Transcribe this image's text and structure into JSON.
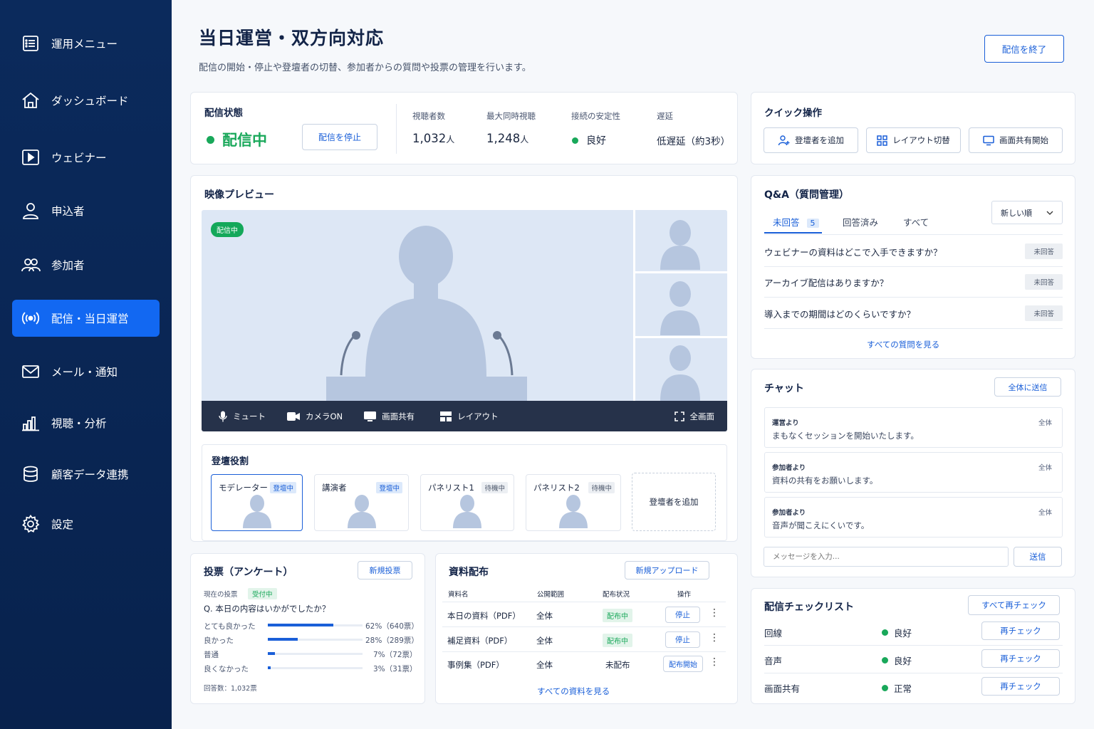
{
  "sidebar": {
    "items": [
      {
        "label": "運用メニュー",
        "icon": "menu-list-icon"
      },
      {
        "label": "ダッシュボード",
        "icon": "home-icon"
      },
      {
        "label": "ウェビナー",
        "icon": "play-icon"
      },
      {
        "label": "申込者",
        "icon": "user-icon"
      },
      {
        "label": "参加者",
        "icon": "users-icon"
      },
      {
        "label": "配信・当日運営",
        "icon": "broadcast-icon",
        "active": true
      },
      {
        "label": "メール・通知",
        "icon": "mail-icon"
      },
      {
        "label": "視聴・分析",
        "icon": "bar-chart-icon"
      },
      {
        "label": "顧客データ連携",
        "icon": "database-icon"
      },
      {
        "label": "設定",
        "icon": "gear-icon"
      }
    ]
  },
  "header": {
    "title": "当日運営・双方向対応",
    "description": "配信の開始・停止や登壇者の切替、参加者からの質問や投票の管理を行います。",
    "end_button": "配信を終了"
  },
  "status": {
    "title": "配信状態",
    "state": "配信中",
    "stop_button": "配信を停止",
    "viewers_label": "視聴者数",
    "viewers_value": "1,032",
    "viewers_unit": "人",
    "peak_label": "最大同時視聴",
    "peak_value": "1,248",
    "peak_unit": "人",
    "stability_label": "接続の安定性",
    "stability_value": "良好",
    "latency_label": "遅延",
    "latency_value": "低遅延（約3秒）"
  },
  "quick": {
    "title": "クイック操作",
    "add_speaker": "登壇者を追加",
    "layout": "レイアウト切替",
    "share": "画面共有開始"
  },
  "preview": {
    "title": "映像プレビュー",
    "live_badge": "配信中",
    "controls": {
      "mute": "ミュート",
      "camera": "カメラON",
      "share": "画面共有",
      "layout": "レイアウト",
      "fullscreen": "全画面"
    }
  },
  "roles": {
    "title": "登壇役割",
    "items": [
      {
        "name": "モデレーター",
        "badge": "登壇中",
        "status": "live"
      },
      {
        "name": "講演者",
        "badge": "登壇中",
        "status": "live"
      },
      {
        "name": "パネリスト1",
        "badge": "待機中",
        "status": "wait"
      },
      {
        "name": "パネリスト2",
        "badge": "待機中",
        "status": "wait"
      }
    ],
    "add": "登壇者を追加"
  },
  "poll": {
    "title": "投票（アンケート）",
    "new_button": "新規投票",
    "current_label": "現在の投票",
    "current_badge": "受付中",
    "question": "Q. 本日の内容はいかがでしたか？",
    "options": [
      {
        "label": "とても良かった",
        "pct": 62,
        "result": "62%（640票）"
      },
      {
        "label": "良かった",
        "pct": 28,
        "result": "28%（289票）"
      },
      {
        "label": "普通",
        "pct": 7,
        "result": "7%（72票）"
      },
      {
        "label": "良くなかった",
        "pct": 3,
        "result": "3%（31票）"
      }
    ],
    "total": "回答数：1,032票"
  },
  "materials": {
    "title": "資料配布",
    "upload_button": "新規アップロード",
    "headers": [
      "資料名",
      "公開範囲",
      "配布状況",
      "操作"
    ],
    "rows": [
      {
        "name": "本日の資料（PDF）",
        "scope": "全体",
        "status": "配布中",
        "action": "停止"
      },
      {
        "name": "補足資料（PDF）",
        "scope": "全体",
        "status": "配布中",
        "action": "停止"
      },
      {
        "name": "事例集（PDF）",
        "scope": "全体",
        "status": "未配布",
        "action": "配布開始"
      }
    ],
    "view_all": "すべての資料を見る"
  },
  "qa": {
    "title": "Q&A（質問管理）",
    "tabs": {
      "unanswered": "未回答",
      "unanswered_count": "5",
      "answered": "回答済み",
      "all": "すべて"
    },
    "sort": "新しい順",
    "questions": [
      {
        "text": "ウェビナーの資料はどこで入手できますか？",
        "status": "未回答"
      },
      {
        "text": "アーカイブ配信はありますか？",
        "status": "未回答"
      },
      {
        "text": "導入までの期間はどのくらいですか？",
        "status": "未回答"
      }
    ],
    "view_all": "すべての質問を見る"
  },
  "chat": {
    "title": "チャット",
    "send_all": "全体に送信",
    "messages": [
      {
        "from": "運営より",
        "to": "全体",
        "text": "まもなくセッションを開始いたします。"
      },
      {
        "from": "参加者より",
        "to": "全体",
        "text": "資料の共有をお願いします。"
      },
      {
        "from": "参加者より",
        "to": "全体",
        "text": "音声が聞こえにくいです。"
      }
    ],
    "placeholder": "メッセージを入力...",
    "send": "送信"
  },
  "checklist": {
    "title": "配信チェックリスト",
    "recheck_all": "すべて再チェック",
    "items": [
      {
        "label": "回線",
        "status": "良好",
        "button": "再チェック"
      },
      {
        "label": "音声",
        "status": "良好",
        "button": "再チェック"
      },
      {
        "label": "画面共有",
        "status": "正常",
        "button": "再チェック"
      }
    ]
  },
  "colors": {
    "primary": "#1268f2",
    "sidebar": "#0b2a5c",
    "live": "#19a85a"
  }
}
